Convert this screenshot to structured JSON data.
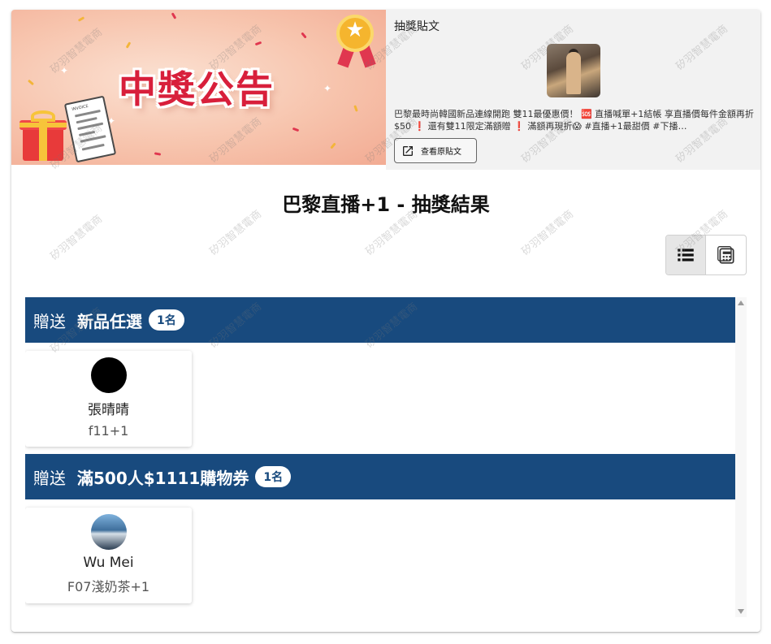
{
  "banner": {
    "title": "中獎公告",
    "receipt_label": "INVOICE"
  },
  "post": {
    "title": "抽獎貼文",
    "text": "巴黎最時尚韓國新品連線開跑 雙11最優惠價！ 🆘 直播喊單+1結帳 享直播價每件金額再折$50 ❗ 還有雙11限定滿額贈 ❗ 滿額再現折😱 #直播+1最甜價 #下播…",
    "view_button_label": "查看原貼文"
  },
  "page_title": "巴黎直播+1 - 抽獎結果",
  "view_toggle": {
    "active": "list"
  },
  "prizes": [
    {
      "kind": "贈送",
      "name": "新品任選",
      "count": "1名",
      "winners": [
        {
          "name": "張晴晴",
          "comment": "f11+1"
        }
      ]
    },
    {
      "kind": "贈送",
      "name": "滿500人$1111購物券",
      "count": "1名",
      "winners": [
        {
          "name": "Wu Mei",
          "comment": "F07淺奶茶+1"
        }
      ]
    }
  ],
  "watermark": "矽羽智慧電商",
  "colors": {
    "prize_header": "#184a7e",
    "banner_red": "#d81f3b",
    "post_bg": "#f2f2f2"
  }
}
